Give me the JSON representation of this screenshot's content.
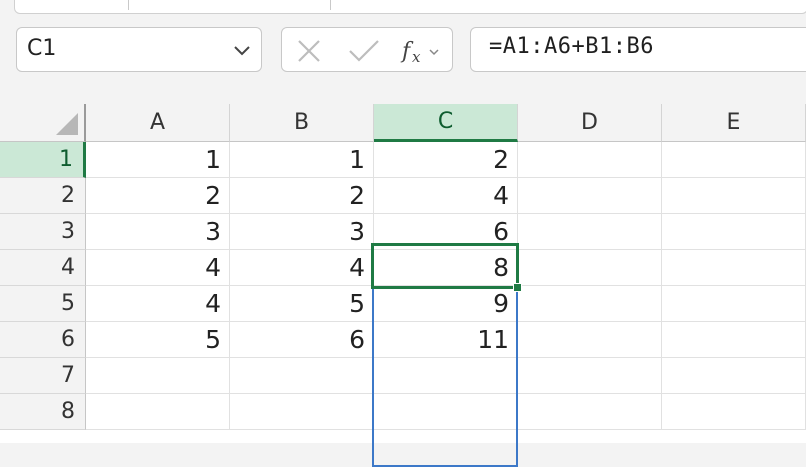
{
  "name_box": {
    "value": "C1"
  },
  "formula_bar": {
    "formula": "=A1:A6+B1:B6"
  },
  "columns": [
    {
      "label": "A",
      "selected": false
    },
    {
      "label": "B",
      "selected": false
    },
    {
      "label": "C",
      "selected": true
    },
    {
      "label": "D",
      "selected": false
    },
    {
      "label": "E",
      "selected": false
    }
  ],
  "rows": [
    {
      "label": "1",
      "selected": true,
      "cells": [
        "1",
        "1",
        "2",
        "",
        ""
      ]
    },
    {
      "label": "2",
      "selected": false,
      "cells": [
        "2",
        "2",
        "4",
        "",
        ""
      ]
    },
    {
      "label": "3",
      "selected": false,
      "cells": [
        "3",
        "3",
        "6",
        "",
        ""
      ]
    },
    {
      "label": "4",
      "selected": false,
      "cells": [
        "4",
        "4",
        "8",
        "",
        ""
      ]
    },
    {
      "label": "5",
      "selected": false,
      "cells": [
        "4",
        "5",
        "9",
        "",
        ""
      ]
    },
    {
      "label": "6",
      "selected": false,
      "cells": [
        "5",
        "6",
        "11",
        "",
        ""
      ]
    },
    {
      "label": "7",
      "selected": false,
      "cells": [
        "",
        "",
        "",
        "",
        ""
      ]
    },
    {
      "label": "8",
      "selected": false,
      "cells": [
        "",
        "",
        "",
        "",
        ""
      ]
    }
  ],
  "icons": {
    "name_box_dropdown": "chevron-down-icon",
    "cancel": "close-icon",
    "enter": "check-icon",
    "insert_function": "function-icon"
  },
  "colors": {
    "selection_green": "#1f7a44",
    "header_highlight": "#cbe8d6",
    "spill_border": "#3c78c8"
  }
}
